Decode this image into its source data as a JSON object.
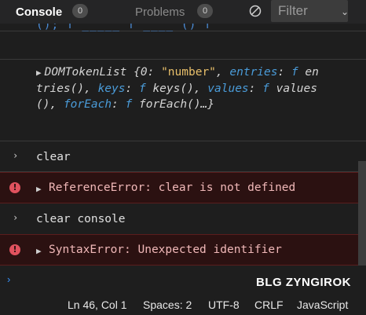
{
  "tabs": {
    "console_label": "Console",
    "console_count": "0",
    "problems_label": "Problems",
    "problems_count": "0"
  },
  "filter": {
    "placeholder": "Filter",
    "chevron": "⌄"
  },
  "console": {
    "partial_line": "(); f _____ f ____ ()  f",
    "object_entry": {
      "type_name": "DOMTokenList",
      "line1_key0": "0",
      "line1_val0": "\"number\"",
      "entries_key": "entries",
      "entries_f": "f",
      "entries_val": "en",
      "line2_cont": "tries(),",
      "keys_key": "keys",
      "keys_f": "f",
      "keys_val": "keys(),",
      "values_key": "values",
      "values_f": "f",
      "values_val": "values",
      "line3_cont": "(),",
      "foreach_key": "forEach",
      "foreach_f": "f",
      "foreach_val": "forEach()…}"
    },
    "command1": "clear",
    "error1": "ReferenceError: clear is not defined",
    "command2": "clear console",
    "error2": "SyntaxError: Unexpected identifier",
    "error_icon": "!"
  },
  "input": {
    "prompt_icon": "›"
  },
  "watermark": "BLG ZYNGIROK",
  "statusbar": {
    "position": "Ln 46, Col 1",
    "spaces": "Spaces: 2",
    "encoding": "UTF-8",
    "eol": "CRLF",
    "language": "JavaScript"
  },
  "colors": {
    "background": "#1e1e1e",
    "error_background": "#2b1111",
    "error_icon": "#e0525e",
    "accent_blue": "#3794ff"
  }
}
